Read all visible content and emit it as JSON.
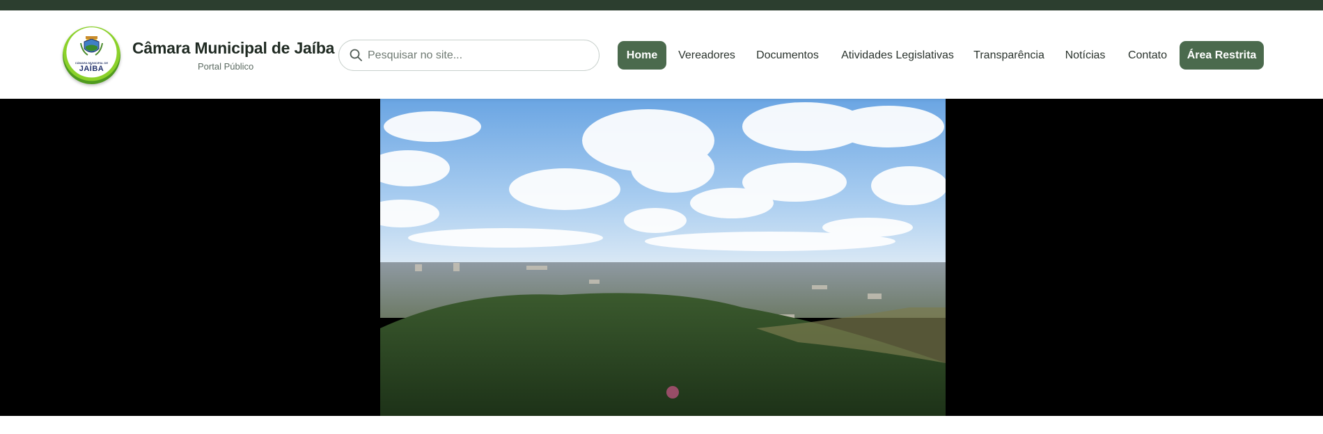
{
  "brand": {
    "logo_top_text": "CÂMARA MUNICIPAL DE",
    "logo_text": "JAÍBA",
    "title": "Câmara Municipal de Jaíba",
    "subtitle": "Portal Público"
  },
  "search": {
    "placeholder": "Pesquisar no site...",
    "value": "",
    "icon": "search-icon"
  },
  "nav": {
    "items": [
      {
        "label": "Home",
        "active": true
      },
      {
        "label": "Vereadores",
        "active": false
      },
      {
        "label": "Documentos",
        "active": false
      },
      {
        "label": "Atividades Legislativas",
        "active": false
      },
      {
        "label": "Transparência",
        "active": false
      },
      {
        "label": "Notícias",
        "active": false
      },
      {
        "label": "Contato",
        "active": false
      }
    ],
    "restricted_label": "Área Restrita"
  },
  "colors": {
    "topbar": "#2c3e2f",
    "accent": "#4b6a4d",
    "hero_background": "#000000",
    "logo_ring": "#6fb823"
  },
  "hero": {
    "media": "aerial-city-video"
  }
}
